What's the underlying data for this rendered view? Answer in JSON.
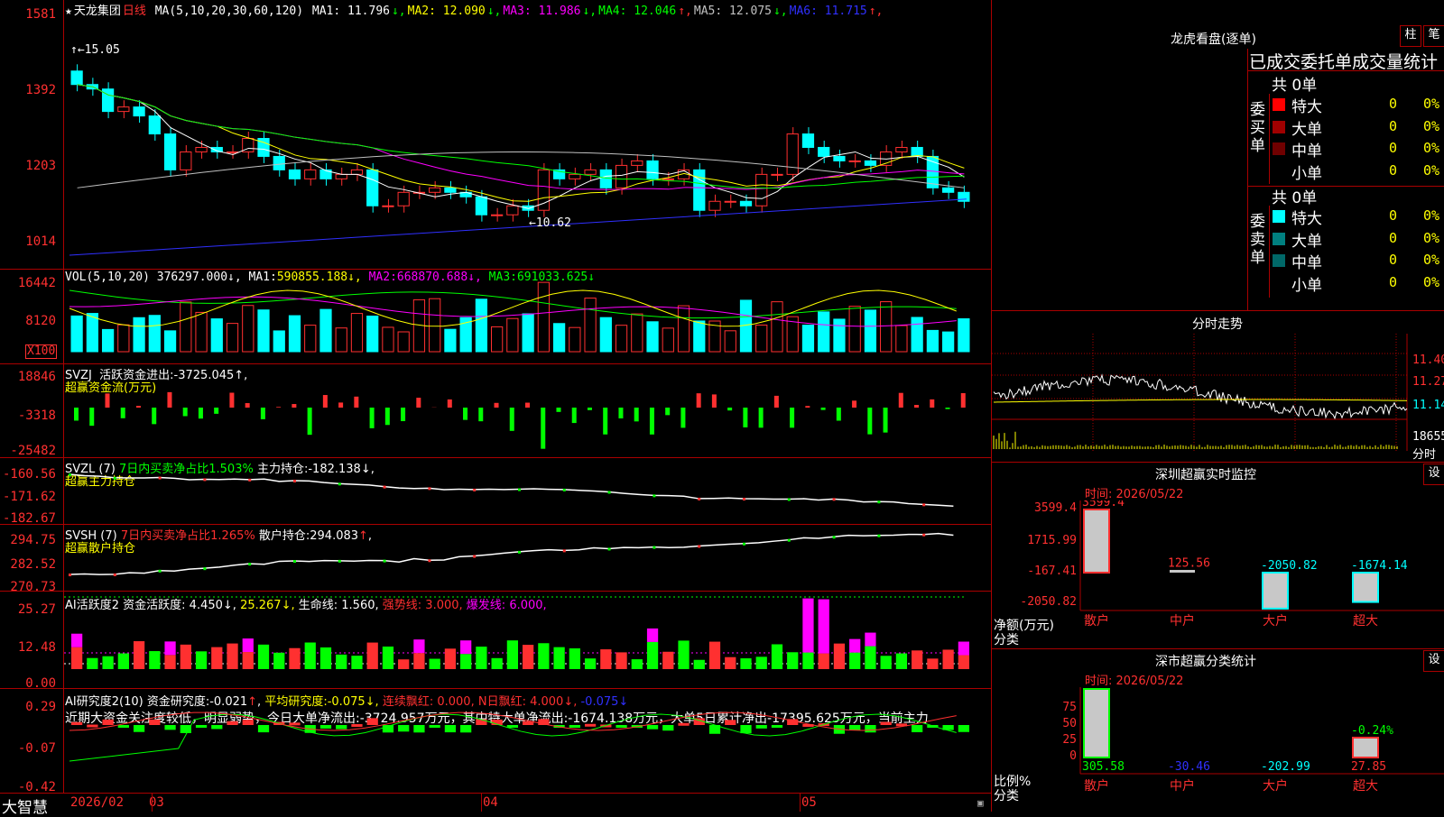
{
  "stock": {
    "star": "★",
    "name": "天龙集团",
    "period": "日线"
  },
  "main": {
    "ma_label": "MA(5,10,20,30,60,120)",
    "ma": [
      {
        "k": "MA1:",
        "v": "11.796",
        "a": "↓",
        "c": "#ffffff"
      },
      {
        "k": "MA2:",
        "v": "12.090",
        "a": "↓",
        "c": "#ffff00"
      },
      {
        "k": "MA3:",
        "v": "11.986",
        "a": "↓",
        "c": "#ff00ff"
      },
      {
        "k": "MA4:",
        "v": "12.046",
        "a": "↑",
        "c": "#00ff00"
      },
      {
        "k": "MA5:",
        "v": "12.075",
        "a": "↓",
        "c": "#c0c0c0"
      },
      {
        "k": "MA6:",
        "v": "11.715",
        "a": "↑",
        "c": "#3030ff"
      }
    ],
    "yaxis": [
      "1581",
      "1392",
      "1203",
      "1014"
    ],
    "high_mark": "15.05",
    "low_mark": "10.62"
  },
  "vol": {
    "title": "VOL(5,10,20)",
    "v": "376297.000",
    "ma1": "590855.188",
    "ma2": "668870.688",
    "ma3": "691033.625",
    "yaxis": [
      "16442",
      "8120"
    ],
    "unit": "X100"
  },
  "svzj": {
    "name": "SVZJ",
    "t1": "活跃资金进出:",
    "v": "-3725.045",
    "sub": "超赢资金流(万元)",
    "yaxis": [
      "18846",
      "-3318",
      "-25482"
    ]
  },
  "svzl": {
    "name": "SVZL (7)",
    "t1": "7日内买卖净占比1.503%",
    "t2": "主力持仓:",
    "v": "-182.138",
    "sub": "超赢主力持仓",
    "yaxis": [
      "-160.56",
      "-171.62",
      "-182.67"
    ]
  },
  "svsh": {
    "name": "SVSH (7)",
    "t1": "7日内买卖净占比1.265%",
    "t2": "散户持仓:",
    "v": "294.083",
    "sub": "超赢散户持仓",
    "yaxis": [
      "294.75",
      "282.52",
      "270.73"
    ]
  },
  "ai1": {
    "name": "AI活跃度2",
    "t1": "资金活跃度:",
    "v1": "4.450",
    "v2": "25.267",
    "t3": "生命线:",
    "v3": "1.560",
    "t4": "强势线:",
    "v4": "3.000",
    "t5": "爆发线:",
    "v5": "6.000",
    "yaxis": [
      "25.27",
      "12.48",
      "0.00"
    ]
  },
  "ai2": {
    "name": "AI研究度2(10)",
    "t1": "资金研究度:",
    "v1": "-0.021",
    "t2": "平均研究度:",
    "v2": "-0.075",
    "t3": "连续飘红:",
    "v3": "0.000",
    "t4": "N日飘红:",
    "v4": "4.000",
    "v5": "-0.075",
    "comment": "近期大资金关注度较低，明显弱势，今日大单净流出:-3724.957万元，其中特大单净流出:-1674.138万元，大单5日累计净出-17395.625万元，当前主力",
    "yaxis": [
      "0.29",
      "-0.07",
      "-0.42"
    ]
  },
  "dates": {
    "brand": "大智慧",
    "d1": "2026/02",
    "d2": "03",
    "d3": "04",
    "d4": "05"
  },
  "lhb": {
    "title": "龙虎看盘(逐单)",
    "btn1": "柱",
    "btn2": "笔",
    "header": "已成交委托单成交量统计",
    "buy": {
      "label": "委买单",
      "total": "共 0单",
      "rows": [
        {
          "n": "特大",
          "v": "0",
          "p": "0%",
          "c": "#ff0000"
        },
        {
          "n": "大单",
          "v": "0",
          "p": "0%",
          "c": "#a00000"
        },
        {
          "n": "中单",
          "v": "0",
          "p": "0%",
          "c": "#700000"
        },
        {
          "n": "小单",
          "v": "0",
          "p": "0%",
          "c": ""
        }
      ]
    },
    "sell": {
      "label": "委卖单",
      "total": "共 0单",
      "rows": [
        {
          "n": "特大",
          "v": "0",
          "p": "0%",
          "c": "#00ffff"
        },
        {
          "n": "大单",
          "v": "0",
          "p": "0%",
          "c": "#008080"
        },
        {
          "n": "中单",
          "v": "0",
          "p": "0%",
          "c": "#006868"
        },
        {
          "n": "小单",
          "v": "0",
          "p": "0%",
          "c": ""
        }
      ]
    }
  },
  "fenshi": {
    "title": "分时走势",
    "yaxis": [
      "11.40",
      "11.27",
      "11.14",
      "18655"
    ],
    "unit": "分时"
  },
  "monitor": {
    "title": "深圳超赢实时监控",
    "btn": "设",
    "time_label": "时间: 2026/05/22",
    "ylabel": "净额(万元)",
    "xlabel": "分类",
    "yaxis": [
      "3599.4",
      "1715.99",
      "-167.41",
      "-2050.82"
    ],
    "bars": [
      {
        "cat": "散户",
        "v": "3599.4"
      },
      {
        "cat": "中户",
        "v": "125.56"
      },
      {
        "cat": "大户",
        "v": "-2050.82"
      },
      {
        "cat": "超大",
        "v": "-1674.14"
      }
    ]
  },
  "classify": {
    "title": "深市超赢分类统计",
    "btn": "设",
    "time_label": "时间: 2026/05/22",
    "ylabel": "比例%",
    "xlabel": "分类",
    "yaxis": [
      "75",
      "50",
      "25",
      "0"
    ],
    "bars": [
      {
        "cat": "散户",
        "v": "305.58"
      },
      {
        "cat": "中户",
        "v": "-30.46"
      },
      {
        "cat": "大户",
        "v": "-202.99"
      },
      {
        "cat": "超大",
        "v": "27.85",
        "top": "-0.24%"
      }
    ]
  }
}
